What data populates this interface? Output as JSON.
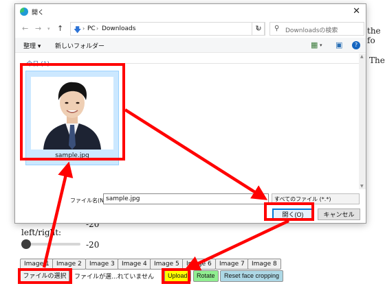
{
  "page": {
    "bg_right_1": "the fo",
    "bg_right_2": "Ther",
    "slider_prev_value": "-20",
    "slider_label": "left/right:",
    "slider_value": "-20",
    "slider_level": 0,
    "image_buttons": [
      "Image 1",
      "Image 2",
      "Image 3",
      "Image 4",
      "Image 5",
      "Image 6",
      "Image 7",
      "Image 8"
    ],
    "file_select_label": "ファイルの選択",
    "file_status": "ファイルが選...れていません",
    "upload_label": "Upload",
    "rotate_label": "Rotate",
    "reset_label": "Reset face cropping",
    "colors": {
      "upload": "#ffff00",
      "rotate": "#90ee90",
      "reset": "#add8e6",
      "highlight": "#ff0000"
    }
  },
  "dialog": {
    "title": "開く",
    "close_icon": "close-icon",
    "nav": {
      "back": "←",
      "forward": "→",
      "up": "↑"
    },
    "breadcrumb": [
      "PC",
      "Downloads"
    ],
    "search_placeholder": "Downloadsの検索",
    "toolbar": {
      "organize": "整理 ▾",
      "new_folder": "新しいフォルダー"
    },
    "group_header": "今日 (1)",
    "files": [
      {
        "name": "sample.jpg"
      }
    ],
    "filename_label": "ファイル名(N):",
    "filename_value": "sample.jpg",
    "filetype_value": "すべてのファイル (*.*)",
    "open_label": "開く(O)",
    "cancel_label": "キャンセル"
  }
}
